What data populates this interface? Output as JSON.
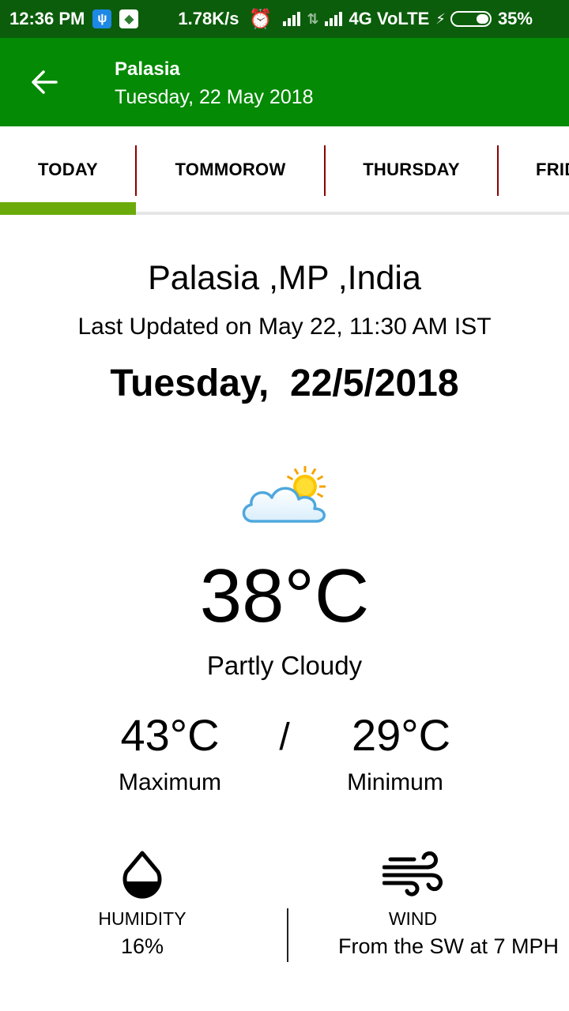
{
  "status_bar": {
    "time": "12:36 PM",
    "speed": "1.78K/s",
    "network": "4G VoLTE",
    "battery": "35%",
    "battery_level": 0.35
  },
  "app_bar": {
    "title": "Palasia",
    "subtitle": "Tuesday, 22 May 2018",
    "back_icon": "arrow-back-icon"
  },
  "tabs": [
    {
      "label": "TODAY",
      "selected": true
    },
    {
      "label": "TOMMOROW",
      "selected": false
    },
    {
      "label": "THURSDAY",
      "selected": false
    },
    {
      "label": "FRID",
      "selected": false
    }
  ],
  "colors": {
    "status_bar": "#0b5d0b",
    "app_bar": "#048a04",
    "tab_indicator": "#6aaa0a",
    "tab_divider": "#8b0000"
  },
  "weather": {
    "location": "Palasia ,MP ,India",
    "last_updated": "Last Updated on May 22, 11:30 AM IST",
    "date_heading": "Tuesday,  22/5/2018",
    "icon": "partly-cloudy-icon",
    "current_temp": "38°C",
    "condition": "Partly Cloudy",
    "max_temp": "43°C",
    "separator": "/",
    "min_temp": "29°C",
    "max_label": "Maximum",
    "min_label": "Minimum"
  },
  "stats": {
    "humidity_label": "HUMIDITY",
    "humidity_value": "16%",
    "wind_label": "WIND",
    "wind_value": "From the SW at 7 MPH"
  }
}
